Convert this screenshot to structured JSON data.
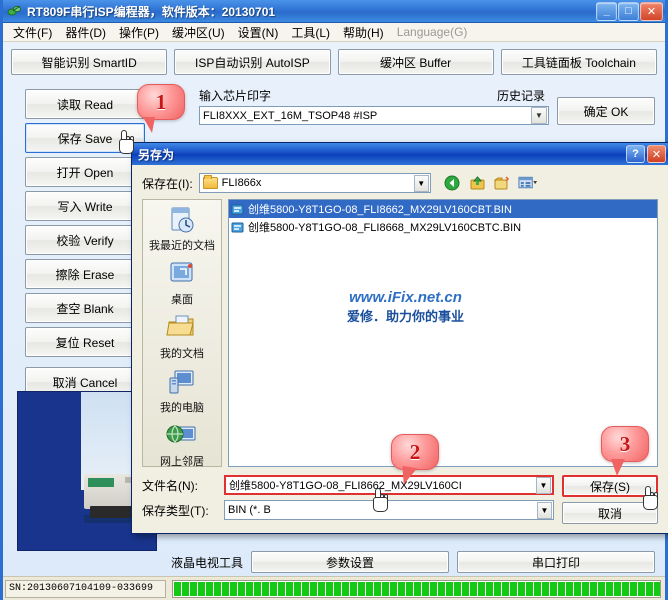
{
  "window": {
    "title": "RT809F串行ISP编程器，软件版本：20130701",
    "icon": "app-icon",
    "minimize": "_",
    "maximize": "□",
    "close": "✕"
  },
  "menu": {
    "items": [
      {
        "label": "文件(F)",
        "disabled": false
      },
      {
        "label": "器件(D)",
        "disabled": false
      },
      {
        "label": "操作(P)",
        "disabled": false
      },
      {
        "label": "缓冲区(U)",
        "disabled": false
      },
      {
        "label": "设置(N)",
        "disabled": false
      },
      {
        "label": "工具(L)",
        "disabled": false
      },
      {
        "label": "帮助(H)",
        "disabled": false
      },
      {
        "label": "Language(G)",
        "disabled": true
      }
    ]
  },
  "toolbar": {
    "buttons": [
      {
        "label": "智能识别 SmartID"
      },
      {
        "label": "ISP自动识别 AutoISP"
      },
      {
        "label": "缓冲区 Buffer"
      },
      {
        "label": "工具链面板 Toolchain"
      }
    ]
  },
  "side_buttons": [
    {
      "label": "读取 Read",
      "focused": false
    },
    {
      "label": "保存 Save",
      "focused": true
    },
    {
      "label": "打开 Open",
      "focused": false
    },
    {
      "label": "写入 Write",
      "focused": false
    },
    {
      "label": "校验 Verify",
      "focused": false
    },
    {
      "label": "擦除 Erase",
      "focused": false
    },
    {
      "label": "查空 Blank",
      "focused": false
    },
    {
      "label": "复位 Reset",
      "focused": false
    },
    {
      "label": "取消 Cancel",
      "focused": false
    }
  ],
  "chip": {
    "input_label": "输入芯片印字",
    "history_label": "历史记录",
    "value": "FLI8XXX_EXT_16M_TSOP48 #ISP",
    "placeholder": "输入芯片印字",
    "ok_button": "确定 OK",
    "dropdown_icon": "chevron-down-icon"
  },
  "dialog": {
    "title": "另存为",
    "help_button": "?",
    "close_button": "✕",
    "save_in_label": "保存在(I):",
    "save_in_value": "FLI866x",
    "toolbar_icons": [
      "back-icon",
      "up-folder-icon",
      "new-folder-icon",
      "views-icon"
    ],
    "places": [
      {
        "label": "我最近的文档",
        "icon": "recent-documents-icon"
      },
      {
        "label": "桌面",
        "icon": "desktop-icon"
      },
      {
        "label": "我的文档",
        "icon": "my-documents-icon"
      },
      {
        "label": "我的电脑",
        "icon": "my-computer-icon"
      },
      {
        "label": "网上邻居",
        "icon": "network-places-icon"
      }
    ],
    "files": [
      {
        "name": "创维5800-Y8T1GO-08_FLI8662_MX29LV160CBT.BIN",
        "selected": true,
        "icon": "bin-file-icon"
      },
      {
        "name": "创维5800-Y8T1GO-08_FLI8668_MX29LV160CBTC.BIN",
        "selected": false,
        "icon": "bin-file-icon"
      }
    ],
    "watermark_line1": "www.iFix.net.cn",
    "watermark_line2": "爱修．助力你的事业",
    "filename_label": "文件名(N):",
    "filename_value": "创维5800-Y8T1GO-08_FLI8662_MX29LV160CI",
    "filetype_label": "保存类型(T):",
    "filetype_value": "BIN (*. B",
    "save_button": "保存(S)",
    "cancel_button": "取消",
    "dropdown_icon": "chevron-down-icon"
  },
  "bottom": {
    "lcd_label": "液晶电视工具",
    "buttons": [
      {
        "label": "参数设置"
      },
      {
        "label": "串口打印"
      }
    ]
  },
  "status": {
    "serial_number": "SN:20130607104109-033699",
    "progress_segments": 64,
    "progress_color": "#14c914"
  },
  "callouts": [
    {
      "number": "1"
    },
    {
      "number": "2"
    },
    {
      "number": "3"
    }
  ],
  "colors": {
    "window_border": "#2a6fd1",
    "title_bar": "#2f73d4",
    "dialog_title_bar": "#1549c4",
    "selection": "#316ac5",
    "callout": "#f06363",
    "watermark": "#2d6fc4"
  }
}
